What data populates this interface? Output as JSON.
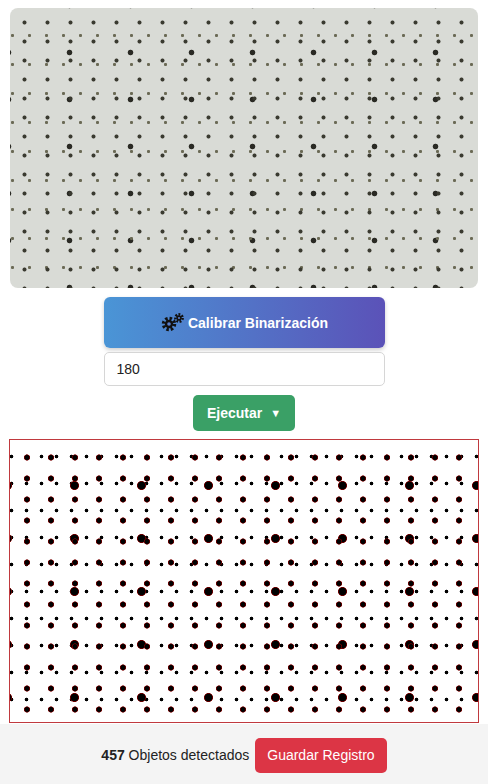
{
  "calibrate_button": {
    "label": "Calibrar Binarización"
  },
  "threshold": {
    "value": "180"
  },
  "run_button": {
    "label": "Ejecutar",
    "icon": "▼"
  },
  "result": {
    "count": "457",
    "label": "Objetos detectados"
  },
  "save_button": {
    "label": "Guardar Registro"
  }
}
